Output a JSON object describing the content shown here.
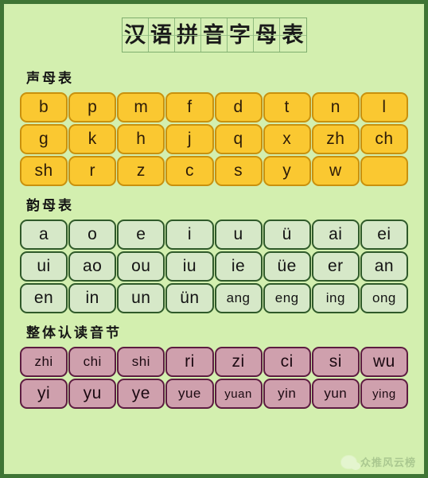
{
  "title": {
    "text": "汉语拼音字母表",
    "chars": [
      "汉",
      "语",
      "拼",
      "音",
      "字",
      "母",
      "表"
    ]
  },
  "sections": [
    {
      "heading": "声母表",
      "kind": "initial",
      "rows": [
        [
          "b",
          "p",
          "m",
          "f",
          "d",
          "t",
          "n",
          "l"
        ],
        [
          "g",
          "k",
          "h",
          "j",
          "q",
          "x",
          "zh",
          "ch"
        ],
        [
          "sh",
          "r",
          "z",
          "c",
          "s",
          "y",
          "w",
          ""
        ]
      ]
    },
    {
      "heading": "韵母表",
      "kind": "final",
      "rows": [
        [
          "a",
          "o",
          "e",
          "i",
          "u",
          "ü",
          "ai",
          "ei"
        ],
        [
          "ui",
          "ao",
          "ou",
          "iu",
          "ie",
          "üe",
          "er",
          "an"
        ],
        [
          "en",
          "in",
          "un",
          "ün",
          "ang",
          "eng",
          "ing",
          "ong"
        ]
      ]
    },
    {
      "heading": "整体认读音节",
      "kind": "whole",
      "rows": [
        [
          "zhi",
          "chi",
          "shi",
          "ri",
          "zi",
          "ci",
          "si",
          "wu"
        ],
        [
          "yi",
          "yu",
          "ye",
          "yue",
          "yuan",
          "yin",
          "yun",
          "ying"
        ]
      ]
    }
  ],
  "watermark": {
    "icon": "wechat-icon",
    "text": "众推风云榜"
  },
  "colors": {
    "page_background": "#d3efaf",
    "frame_border": "#3f7535",
    "initial_fill": "#fac831",
    "initial_border": "#c9910d",
    "final_fill": "#d6e8c8",
    "final_border": "#2f5a2a",
    "whole_fill": "#cfa0ad",
    "whole_border": "#5d1c41"
  }
}
